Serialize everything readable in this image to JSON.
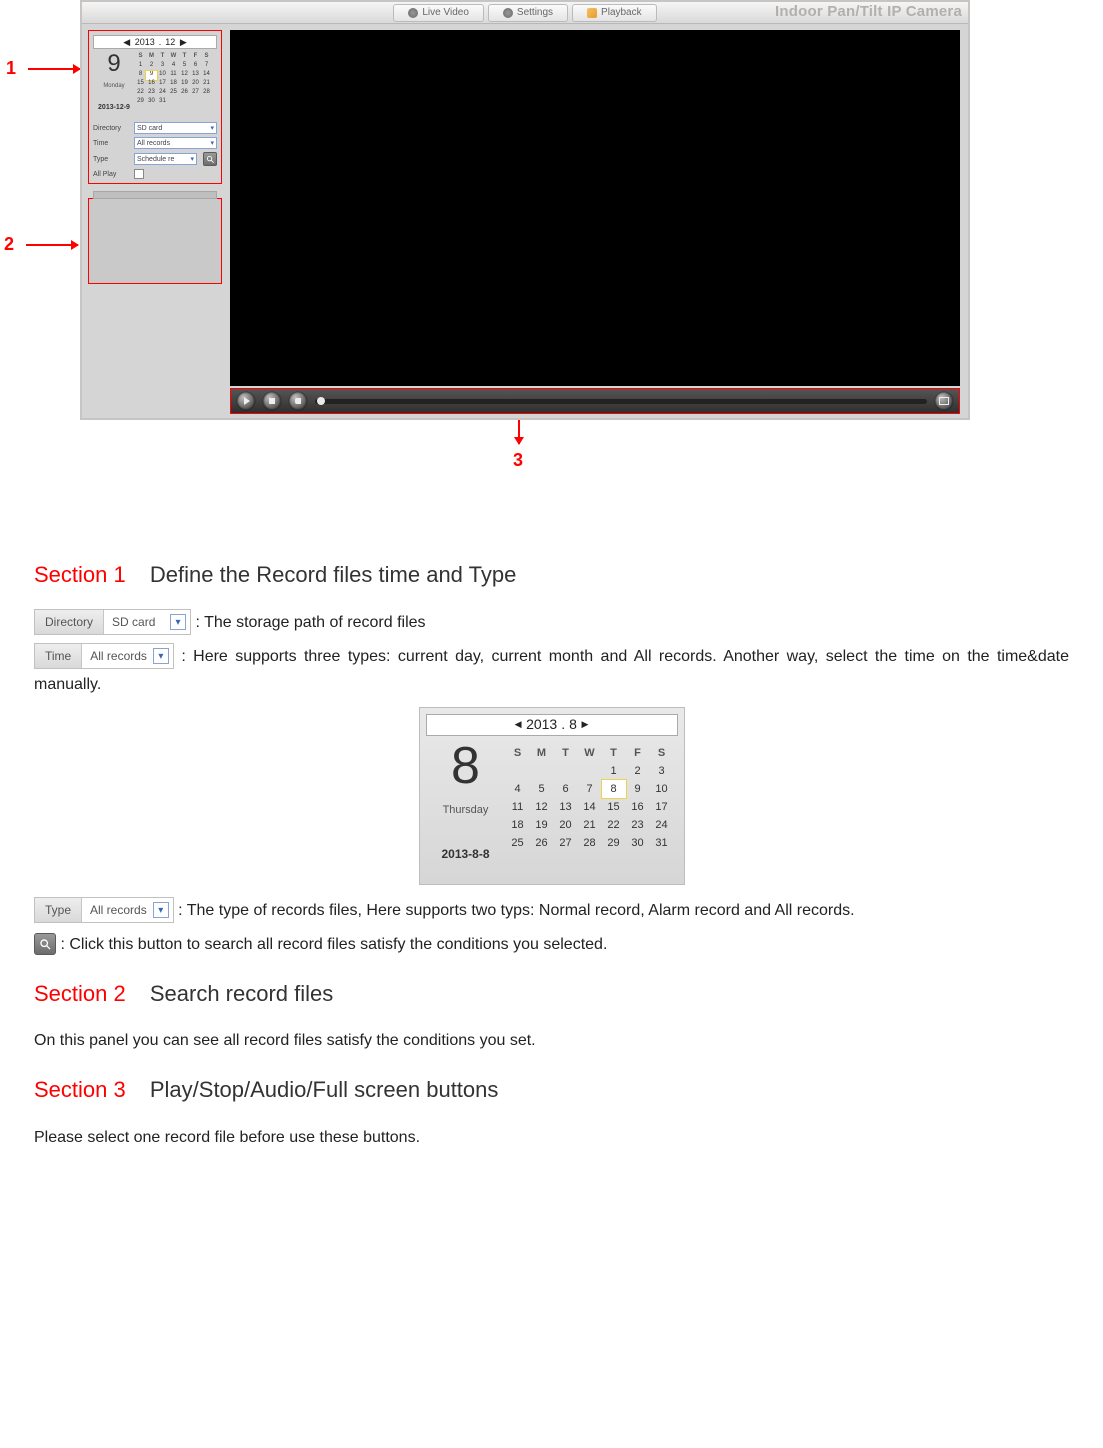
{
  "tabs": {
    "live": "Live Video",
    "settings": "Settings",
    "playback": "Playback"
  },
  "brand": "Indoor Pan/Tilt IP Camera",
  "callouts": {
    "one": "1",
    "two": "2",
    "three": "3"
  },
  "small_cal": {
    "year": "2013",
    "month": "12",
    "big_day": "9",
    "dow": "Monday",
    "date": "2013-12-9",
    "hdr": [
      "S",
      "M",
      "T",
      "W",
      "T",
      "F",
      "S"
    ],
    "rows": [
      [
        "1",
        "2",
        "3",
        "4",
        "5",
        "6",
        "7"
      ],
      [
        "8",
        "9",
        "10",
        "11",
        "12",
        "13",
        "14"
      ],
      [
        "15",
        "16",
        "17",
        "18",
        "19",
        "20",
        "21"
      ],
      [
        "22",
        "23",
        "24",
        "25",
        "26",
        "27",
        "28"
      ],
      [
        "29",
        "30",
        "31",
        "",
        "",
        "",
        ""
      ]
    ],
    "sel": "9"
  },
  "filters": {
    "directory_label": "Directory",
    "directory_value": "SD card",
    "time_label": "Time",
    "time_value": "All records",
    "type_label": "Type",
    "type_value": "Schedule re",
    "allplay_label": "All Play"
  },
  "doc": {
    "s1_num": "Section 1",
    "s1_title": "Define the Record files time and Type",
    "dir_desc": ": The storage path of record files",
    "time_desc": ": Here supports three types: current day, current month and All records. Another way, select the time on the time&date manually.",
    "type_desc": ": The type of records files, Here supports two typs: Normal record, Alarm record and All records.",
    "search_desc": ": Click this button to search all record files satisfy the conditions you selected.",
    "chip_dir_label": "Directory",
    "chip_dir_value": "SD card",
    "chip_time_label": "Time",
    "chip_time_value": "All records",
    "chip_type_label": "Type",
    "chip_type_value": "All records",
    "big_cal": {
      "year": "2013",
      "month": "8",
      "big_day": "8",
      "dow": "Thursday",
      "date": "2013-8-8",
      "hdr": [
        "S",
        "M",
        "T",
        "W",
        "T",
        "F",
        "S"
      ],
      "rows": [
        [
          "",
          "",
          "",
          "",
          "1",
          "2",
          "3"
        ],
        [
          "4",
          "5",
          "6",
          "7",
          "8",
          "9",
          "10"
        ],
        [
          "11",
          "12",
          "13",
          "14",
          "15",
          "16",
          "17"
        ],
        [
          "18",
          "19",
          "20",
          "21",
          "22",
          "23",
          "24"
        ],
        [
          "25",
          "26",
          "27",
          "28",
          "29",
          "30",
          "31"
        ]
      ],
      "sel": "8"
    },
    "s2_num": "Section 2",
    "s2_title": "Search record files",
    "s2_text": "On this panel you can see all record files satisfy the conditions you set.",
    "s3_num": "Section 3",
    "s3_title": "Play/Stop/Audio/Full screen buttons",
    "s3_text": "Please select one record file before use these buttons."
  }
}
